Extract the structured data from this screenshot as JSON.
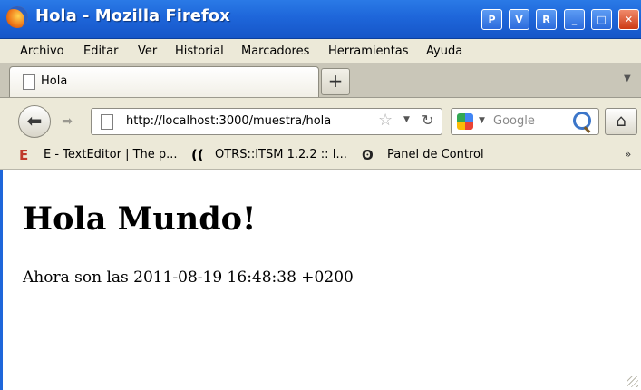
{
  "window": {
    "title": "Hola - Mozilla Firefox",
    "buttons": [
      "P",
      "V",
      "R"
    ]
  },
  "menubar": {
    "items": [
      "Archivo",
      "Editar",
      "Ver",
      "Historial",
      "Marcadores",
      "Herramientas",
      "Ayuda"
    ]
  },
  "tabs": {
    "active_label": "Hola",
    "new_tab_label": "+"
  },
  "navigation": {
    "url": "http://localhost:3000/muestra/hola",
    "search_placeholder": "Google"
  },
  "bookmarks": {
    "items": [
      "E - TextEditor | The p...",
      "OTRS::ITSM 1.2.2 :: I...",
      "Panel de Control"
    ],
    "more": "»"
  },
  "page": {
    "heading": "Hola Mundo!",
    "time_text": "Ahora son las 2011-08-19 16:48:38 +0200"
  },
  "colors": {
    "titlebar": "#1e66da",
    "chrome": "#ece9d8",
    "close_button": "#cd3a14"
  }
}
